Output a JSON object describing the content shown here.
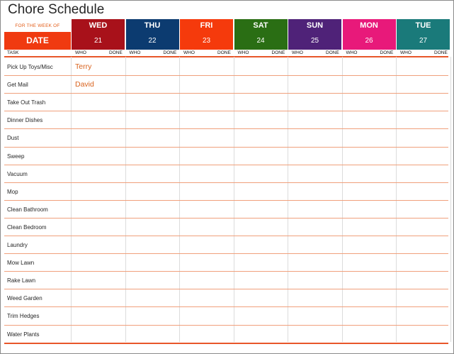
{
  "title": "Chore Schedule",
  "week_label": "FOR THE WEEK OF",
  "date_label": "DATE",
  "colors": {
    "accent": "#f03a10",
    "line": "#e8562a",
    "who_text": "#d9631e"
  },
  "days": [
    {
      "name": "WED",
      "num": "21",
      "color": "#a8111a"
    },
    {
      "name": "THU",
      "num": "22",
      "color": "#0c3b70"
    },
    {
      "name": "FRI",
      "num": "23",
      "color": "#f53a0c"
    },
    {
      "name": "SAT",
      "num": "24",
      "color": "#2a6e14"
    },
    {
      "name": "SUN",
      "num": "25",
      "color": "#4f2278"
    },
    {
      "name": "MON",
      "num": "26",
      "color": "#e8197a"
    },
    {
      "name": "TUE",
      "num": "27",
      "color": "#1a7a7a"
    }
  ],
  "subheaders": {
    "task": "TASK",
    "who": "WHO",
    "done": "DONE"
  },
  "tasks": [
    {
      "label": "Pick Up Toys/Misc",
      "wed_who": "Terry"
    },
    {
      "label": "Get Mail",
      "wed_who": "David"
    },
    {
      "label": "Take Out Trash",
      "wed_who": ""
    },
    {
      "label": "Dinner Dishes",
      "wed_who": ""
    },
    {
      "label": "Dust",
      "wed_who": ""
    },
    {
      "label": "Sweep",
      "wed_who": ""
    },
    {
      "label": "Vacuum",
      "wed_who": ""
    },
    {
      "label": "Mop",
      "wed_who": ""
    },
    {
      "label": "Clean Bathroom",
      "wed_who": ""
    },
    {
      "label": "Clean Bedroom",
      "wed_who": ""
    },
    {
      "label": "Laundry",
      "wed_who": ""
    },
    {
      "label": "Mow Lawn",
      "wed_who": ""
    },
    {
      "label": "Rake Lawn",
      "wed_who": ""
    },
    {
      "label": "Weed Garden",
      "wed_who": ""
    },
    {
      "label": "Trim Hedges",
      "wed_who": ""
    },
    {
      "label": "Water Plants",
      "wed_who": ""
    }
  ]
}
